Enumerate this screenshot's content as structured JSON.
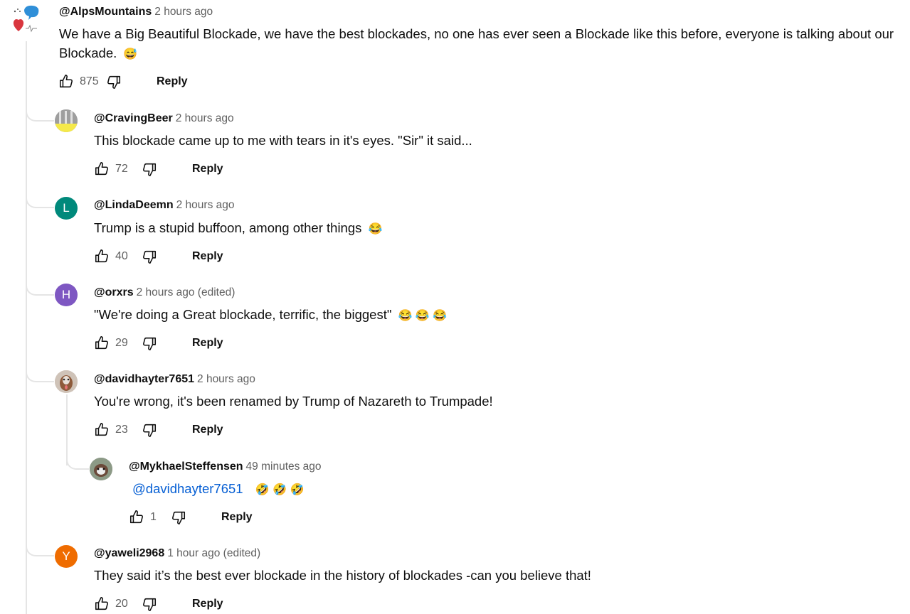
{
  "comment": {
    "author": "@AlpsMountains",
    "time": "2 hours ago",
    "text": "We have a Big Beautiful Blockade, we have the best blockades, no one has ever seen a Blockade like this before, everyone is talking about our Blockade.",
    "emoji": "😅",
    "likes": "875",
    "reply_label": "Reply"
  },
  "replies": [
    {
      "author": "@CravingBeer",
      "time": "2 hours ago",
      "text": "This blockade came up to me with tears in it's eyes. \"Sir\" it said...",
      "emoji": "",
      "likes": "72",
      "reply_label": "Reply"
    },
    {
      "author": "@LindaDeemn",
      "time": "2 hours ago",
      "avatar_letter": "L",
      "avatar_color": "#00897b",
      "text": "Trump is a stupid buffoon, among other things",
      "emoji": "😂",
      "likes": "40",
      "reply_label": "Reply"
    },
    {
      "author": "@orxrs",
      "time": "2 hours ago (edited)",
      "avatar_letter": "H",
      "avatar_color": "#7e57c2",
      "text": "\"We're doing a Great blockade, terrific, the biggest\"",
      "emoji": "😂 😂 😂",
      "likes": "29",
      "reply_label": "Reply"
    },
    {
      "author": "@davidhayter7651",
      "time": "2 hours ago",
      "text": "You're wrong, it's been renamed by Trump of Nazareth to Trumpade!",
      "emoji": "",
      "likes": "23",
      "reply_label": "Reply"
    },
    {
      "author": "@MykhaelSteffensen",
      "time": "49 minutes ago",
      "mention": "@davidhayter7651",
      "text": "",
      "emoji": "🤣 🤣 🤣",
      "likes": "1",
      "reply_label": "Reply"
    },
    {
      "author": "@yaweli2968",
      "time": "1 hour ago (edited)",
      "avatar_letter": "Y",
      "avatar_color": "#ef6c00",
      "text": "They said it’s the best ever blockade in the history of blockades -can you believe that!",
      "emoji": "",
      "likes": "20",
      "reply_label": "Reply"
    }
  ],
  "icons": {
    "like": "thumbs-up-icon",
    "dislike": "thumbs-down-icon"
  }
}
